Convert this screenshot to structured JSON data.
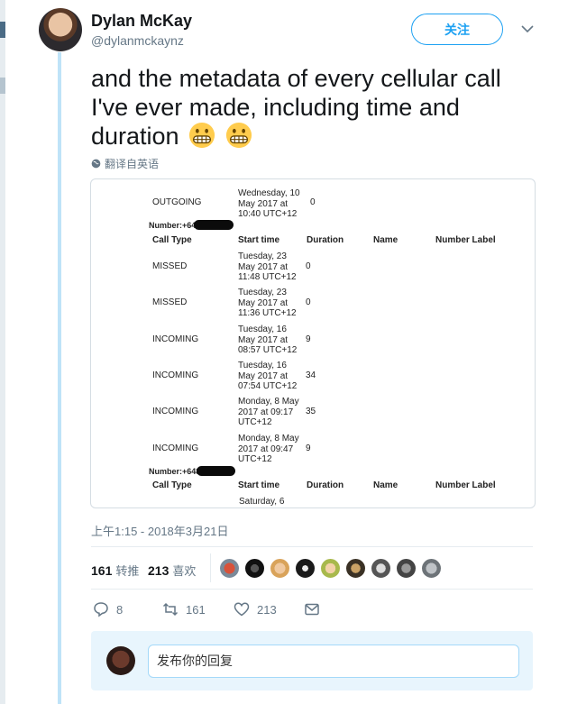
{
  "user": {
    "display_name": "Dylan McKay",
    "handle": "@dylanmckaynz",
    "follow_label": "关注"
  },
  "tweet": {
    "text": "and the metadata of every cellular call I've ever made, including time and duration",
    "emoji": [
      "grimacing-face",
      "grimacing-face"
    ],
    "translate_label": "翻译自英语",
    "timestamp": "上午1:15 - 2018年3月21日"
  },
  "document": {
    "top_row": {
      "call_type": "OUTGOING",
      "start_time": [
        "Wednesday, 10",
        "May 2017 at",
        "10:40 UTC+12"
      ],
      "duration": "0"
    },
    "number_label_1": "Number:+641",
    "number_label_2": "Number:+648",
    "headers": [
      "Call Type",
      "Start time",
      "Duration",
      "Name",
      "Number Label"
    ],
    "rows": [
      {
        "call_type": "MISSED",
        "start_time": [
          "Tuesday, 23",
          "May 2017 at",
          "11:48 UTC+12"
        ],
        "duration": "0"
      },
      {
        "call_type": "MISSED",
        "start_time": [
          "Tuesday, 23",
          "May 2017 at",
          "11:36 UTC+12"
        ],
        "duration": "0"
      },
      {
        "call_type": "INCOMING",
        "start_time": [
          "Tuesday, 16",
          "May 2017 at",
          "08:57 UTC+12"
        ],
        "duration": "9"
      },
      {
        "call_type": "INCOMING",
        "start_time": [
          "Tuesday, 16",
          "May 2017 at",
          "07:54 UTC+12"
        ],
        "duration": "34"
      },
      {
        "call_type": "INCOMING",
        "start_time": [
          "Monday, 8 May",
          "2017 at 09:17",
          "UTC+12"
        ],
        "duration": "35"
      },
      {
        "call_type": "INCOMING",
        "start_time": [
          "Monday, 8 May",
          "2017 at 09:47",
          "UTC+12"
        ],
        "duration": "9"
      }
    ],
    "bottom_partial": "Saturday, 6"
  },
  "stats": {
    "retweets_count": "161",
    "retweets_label": "转推",
    "likes_count": "213",
    "likes_label": "喜欢"
  },
  "actions": {
    "reply_count": "8",
    "retweet_count": "161",
    "like_count": "213"
  },
  "reply": {
    "placeholder": "发布你的回复"
  },
  "colors": {
    "accent": "#1da1f2",
    "thread_line": "#bfe3f8",
    "muted": "#657786"
  }
}
